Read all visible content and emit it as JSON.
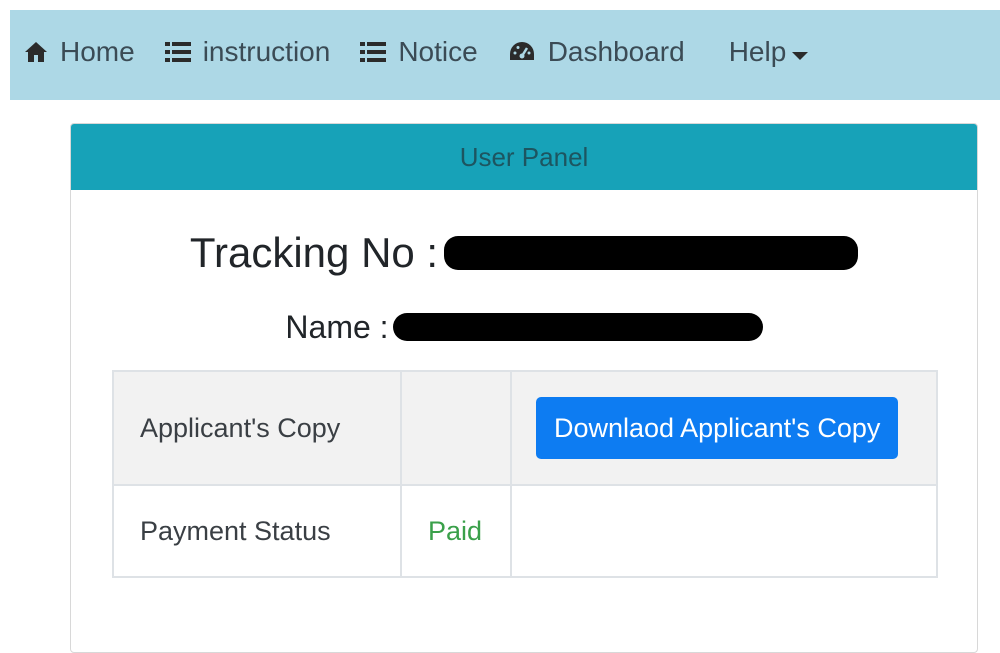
{
  "navbar": {
    "background": "#add8e6",
    "items": [
      {
        "label": "Home",
        "icon": "home-icon"
      },
      {
        "label": "instruction",
        "icon": "list-icon"
      },
      {
        "label": "Notice",
        "icon": "list-icon"
      },
      {
        "label": "Dashboard",
        "icon": "dashboard-icon"
      },
      {
        "label": "Help",
        "icon": "caret-down-icon"
      }
    ]
  },
  "panel": {
    "header": "User Panel",
    "header_color": "#17a2b8",
    "tracking_label": "Tracking No :",
    "name_label": "Name :"
  },
  "table": {
    "rows": [
      {
        "label": "Applicant's Copy",
        "value": "",
        "action": "Downlaod Applicant's Copy"
      },
      {
        "label": "Payment Status",
        "value": "Paid",
        "action": ""
      }
    ],
    "button_color": "#0d7cf2",
    "paid_color": "#3aa04a"
  }
}
